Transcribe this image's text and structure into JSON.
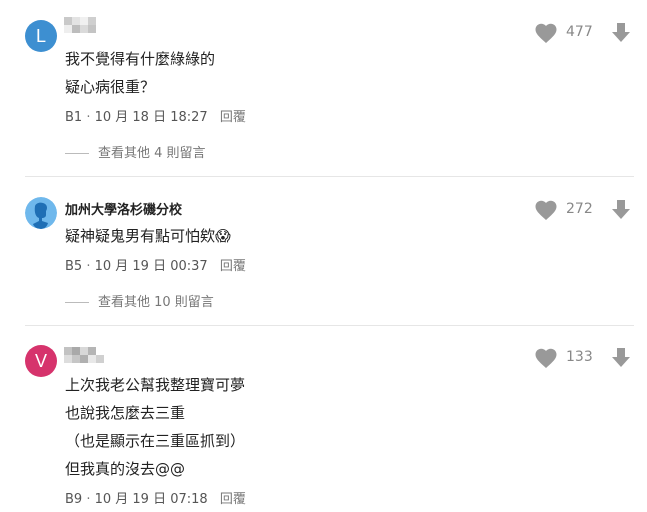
{
  "comments": [
    {
      "avatar_letter": "L",
      "avatar_color": "#3d8fd1",
      "author": "",
      "lines": [
        "我不覺得有什麼綠綠的",
        "疑心病很重？"
      ],
      "floor": "B1",
      "date": "10 月 18 日 18:27",
      "reply_label": "回覆",
      "likes": "477",
      "more_replies": "查看其他 4 則留言"
    },
    {
      "avatar_color": "#5aa9e6",
      "author": "加州大學洛杉磯分校",
      "lines": [
        "疑神疑鬼男有點可怕欸😱"
      ],
      "floor": "B5",
      "date": "10 月 19 日 00:37",
      "reply_label": "回覆",
      "likes": "272",
      "more_replies": "查看其他 10 則留言"
    },
    {
      "avatar_letter": "V",
      "avatar_color": "#d6336c",
      "author": "",
      "lines": [
        "上次我老公幫我整理寶可夢",
        "也說我怎麼去三重",
        "（也是顯示在三重區抓到）",
        "但我真的沒去@@"
      ],
      "floor": "B9",
      "date": "10 月 19 日 07:18",
      "reply_label": "回覆",
      "likes": "133",
      "more_replies": ""
    }
  ],
  "icons": {
    "like": "heart-icon",
    "down": "down-arrow-icon"
  },
  "colors": {
    "icon_gray": "#999999",
    "text_muted": "#777777"
  }
}
